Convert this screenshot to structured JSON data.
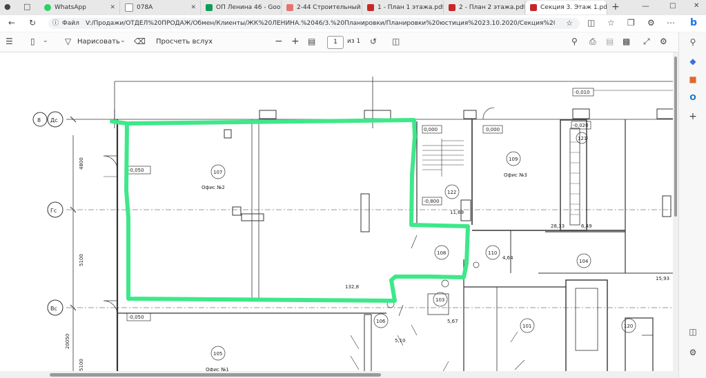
{
  "browser": {
    "tabs": [
      {
        "label": "WhatsApp",
        "icon": "whatsapp-icon",
        "color": "#25d366"
      },
      {
        "label": "078A",
        "icon": "document-icon",
        "color": "#9e9e9e"
      },
      {
        "label": "ОП Ленина 46 - Goo",
        "icon": "sheets-icon",
        "color": "#0f9d58"
      },
      {
        "label": "2-44 Строительный",
        "icon": "pdf-icon",
        "color": "#e57373"
      },
      {
        "label": "1 - План 1 этажа.pdf",
        "icon": "pdf-icon",
        "color": "#c62828"
      },
      {
        "label": "2 - План 2 этажа.pdf",
        "icon": "pdf-icon",
        "color": "#c62828"
      },
      {
        "label": "Секция 3. Этаж 1.pdf",
        "icon": "pdf-icon",
        "color": "#c62828"
      }
    ],
    "file_label": "Файл",
    "url": "V:/Продажи/ОТДЕЛ%20ПРОДАЖ/Обмен/Клиенты/ЖК%20ЛЕНИНА.%2046/3.%20Планировки/Планировки%20юстиция%2023.10.2020/Секция%203/С..."
  },
  "pdf_toolbar": {
    "draw_label": "Нарисовать",
    "fit_label": "Просчеть вслух",
    "page_current": "1",
    "page_total": "из 1"
  },
  "plan": {
    "axes": {
      "dc": "Дс",
      "gc": "Гс",
      "vc": "Вс",
      "eight": "8"
    },
    "dims": {
      "d4800": "4800",
      "d5100a": "5100",
      "d20050": "20050",
      "d5100b": "5100"
    },
    "levels": {
      "l0010": "-0,010",
      "l0050a": "-0,050",
      "l0050b": "-0,050",
      "l0000a": "0,000",
      "l0000b": "0,000",
      "l0020": "-0,020",
      "l0800": "-0,800"
    },
    "rooms": {
      "r107": "107",
      "r109": "109",
      "r121": "121",
      "r122": "122",
      "r108": "108",
      "r110": "110",
      "r104": "104",
      "r103": "103",
      "r106": "106",
      "r101": "101",
      "r120": "120",
      "r105": "105"
    },
    "room_names": {
      "office2": "Офис №2",
      "office3": "Офис №3",
      "office1": "Офис №1"
    },
    "areas": {
      "a1169": "11,69",
      "a2833": "28,33",
      "a649": "6,49",
      "a464": "4,64",
      "a1593": "15,93",
      "a567": "5,67",
      "a510": "5,10",
      "a1328": "132,8"
    }
  },
  "colors": {
    "highlight": "#3ee88a"
  }
}
